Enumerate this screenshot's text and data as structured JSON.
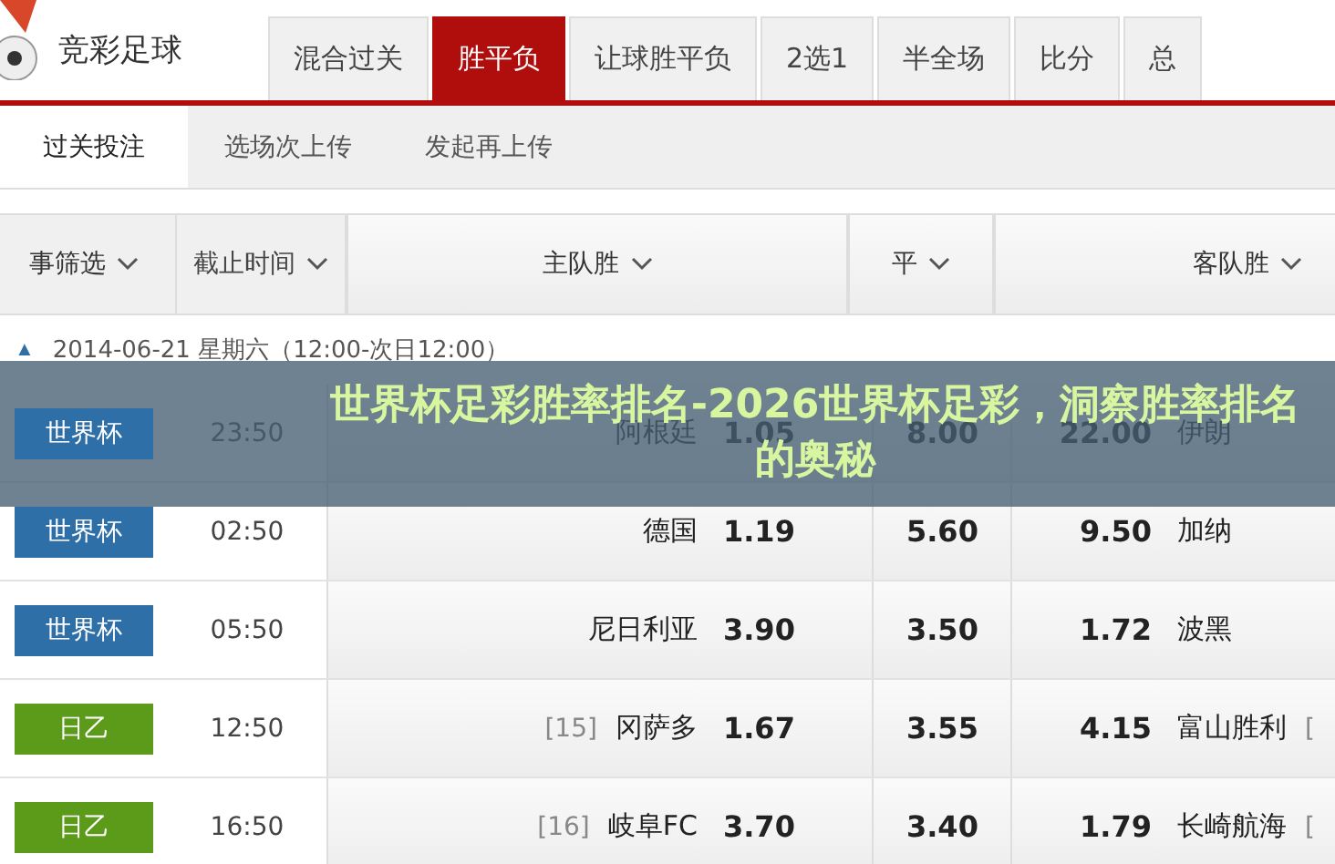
{
  "logo": {
    "title": "竞彩足球"
  },
  "tabs": [
    {
      "label": "混合过关",
      "selected": false
    },
    {
      "label": "胜平负",
      "selected": true
    },
    {
      "label": "让球胜平负",
      "selected": false
    },
    {
      "label": "2选1",
      "selected": false
    },
    {
      "label": "半全场",
      "selected": false
    },
    {
      "label": "比分",
      "selected": false
    },
    {
      "label": "总",
      "selected": false
    }
  ],
  "subtabs": [
    {
      "label": "过关投注",
      "selected": true
    },
    {
      "label": "选场次上传",
      "selected": false
    },
    {
      "label": "发起再上传",
      "selected": false
    }
  ],
  "columns": [
    "事筛选",
    "截止时间",
    "主队胜",
    "平",
    "客队胜"
  ],
  "date_row": {
    "toggle": "▲",
    "text": "2014-06-21 星期六（12:00-次日12:00）"
  },
  "rows": [
    {
      "league": "世界杯",
      "color": "#2f6fa8",
      "time": "23:50",
      "home_rank": "",
      "home": "阿根廷",
      "home_odds": "1.05",
      "draw_odds": "8.00",
      "away_odds": "22.00",
      "away": "伊朗",
      "away_rank": ""
    },
    {
      "league": "世界杯",
      "color": "#2f6fa8",
      "time": "02:50",
      "home_rank": "",
      "home": "德国",
      "home_odds": "1.19",
      "draw_odds": "5.60",
      "away_odds": "9.50",
      "away": "加纳",
      "away_rank": ""
    },
    {
      "league": "世界杯",
      "color": "#2f6fa8",
      "time": "05:50",
      "home_rank": "",
      "home": "尼日利亚",
      "home_odds": "3.90",
      "draw_odds": "3.50",
      "away_odds": "1.72",
      "away": "波黑",
      "away_rank": ""
    },
    {
      "league": "日乙",
      "color": "#5c9a1a",
      "time": "12:50",
      "home_rank": "[15]",
      "home": "冈萨多",
      "home_odds": "1.67",
      "draw_odds": "3.55",
      "away_odds": "4.15",
      "away": "富山胜利",
      "away_rank": "["
    },
    {
      "league": "日乙",
      "color": "#5c9a1a",
      "time": "16:50",
      "home_rank": "[16]",
      "home": "岐阜FC",
      "home_odds": "3.70",
      "draw_odds": "3.40",
      "away_odds": "1.79",
      "away": "长崎航海",
      "away_rank": "["
    }
  ],
  "banner": {
    "title": "世界杯足彩胜率排名-2026世界杯足彩，洞察胜率排名的奥秘"
  }
}
